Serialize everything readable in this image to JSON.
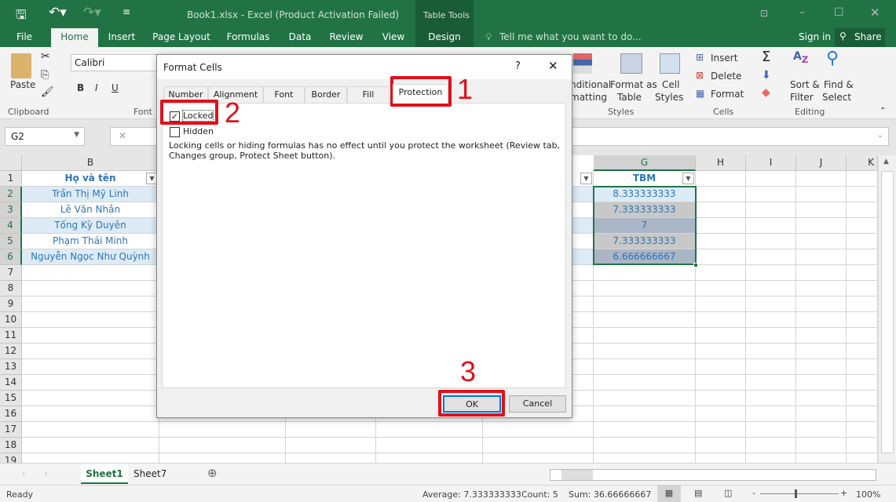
{
  "window": {
    "title": "Book1.xlsx - Excel (Product Activation Failed)",
    "context_tab": "Table Tools"
  },
  "ribbon_tabs": [
    "File",
    "Home",
    "Insert",
    "Page Layout",
    "Formulas",
    "Data",
    "Review",
    "View",
    "Design"
  ],
  "tell_me": "Tell me what you want to do...",
  "sign_in": "Sign in",
  "share": "Share",
  "ribbon": {
    "paste": "Paste",
    "clipboard": "Clipboard",
    "font_name": "Calibri",
    "font": "Font",
    "bold": "B",
    "italic": "I",
    "underline": "U",
    "conditional1": "nditional",
    "conditional2": "matting",
    "format_as1": "Format as",
    "format_as2": "Table",
    "cell_styles1": "Cell",
    "cell_styles2": "Styles",
    "styles": "Styles",
    "insert": "Insert",
    "delete": "Delete",
    "format": "Format",
    "cells": "Cells",
    "sort1": "Sort &",
    "sort2": "Filter",
    "find1": "Find &",
    "find2": "Select",
    "editing": "Editing"
  },
  "name_box": "G2",
  "columns": {
    "B": "B",
    "G": "G",
    "H": "H",
    "I": "I",
    "J": "J",
    "K": "K"
  },
  "rows": [
    "1",
    "2",
    "3",
    "4",
    "5",
    "6",
    "7",
    "8",
    "9",
    "10",
    "11",
    "12",
    "13",
    "14",
    "15",
    "16",
    "17",
    "18",
    "19"
  ],
  "table": {
    "header_b": "Họ và tên",
    "header_g": "TBM",
    "names": [
      "Trần Thị Mỹ Linh",
      "Lê Văn Nhân",
      "Tống Kỳ Duyên",
      "Phạm Thái Minh",
      "Nguyễn Ngọc Như Quỳnh"
    ],
    "tbm": [
      "8.333333333",
      "7.333333333",
      "7",
      "7.333333333",
      "6.666666667"
    ]
  },
  "dialog": {
    "title": "Format Cells",
    "help": "?",
    "tabs": [
      "Number",
      "Alignment",
      "Font",
      "Border",
      "Fill",
      "Protection"
    ],
    "locked": "Locked",
    "locked_checked": true,
    "hidden": "Hidden",
    "hidden_checked": false,
    "note1": "Locking cells or hiding formulas has no effect until you protect the worksheet (Review tab,",
    "note2": "Changes group, Protect Sheet button).",
    "ok": "OK",
    "cancel": "Cancel"
  },
  "annotations": [
    "1",
    "2",
    "3"
  ],
  "sheets": [
    "Sheet1",
    "Sheet7"
  ],
  "status": {
    "ready": "Ready",
    "average": "Average: 7.333333333",
    "count": "Count: 5",
    "sum": "Sum: 36.66666667",
    "zoom": "100%"
  },
  "colors": {
    "excel_green": "#217346",
    "annotation_red": "#e0101a",
    "table_blue": "#2f75b5"
  }
}
